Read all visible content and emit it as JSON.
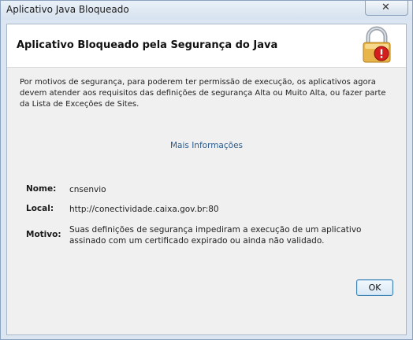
{
  "window": {
    "title": "Aplicativo Java Bloqueado",
    "close_glyph": "✕"
  },
  "header": {
    "title": "Aplicativo Bloqueado pela Segurança do Java",
    "icon": "padlock-warning-icon"
  },
  "message": "Por motivos de segurança, para poderem ter permissão de execução, os aplicativos agora devem atender aos requisitos das definições de segurança Alta ou Muito Alta, ou fazer parte da Lista de Exceções de Sites.",
  "more_info_link": "Mais Informações",
  "details": {
    "name_label": "Nome:",
    "name_value": "cnsenvio",
    "location_label": "Local:",
    "location_value": "http://conectividade.caixa.gov.br:80",
    "reason_label": "Motivo:",
    "reason_value": "Suas definições de segurança impediram a execução de um aplicativo assinado com um certificado expirado ou ainda não validado."
  },
  "buttons": {
    "ok_label": "OK"
  },
  "colors": {
    "link": "#2a5a8c",
    "lock_body": "#e8b54a",
    "warning_badge": "#d41f1f"
  }
}
